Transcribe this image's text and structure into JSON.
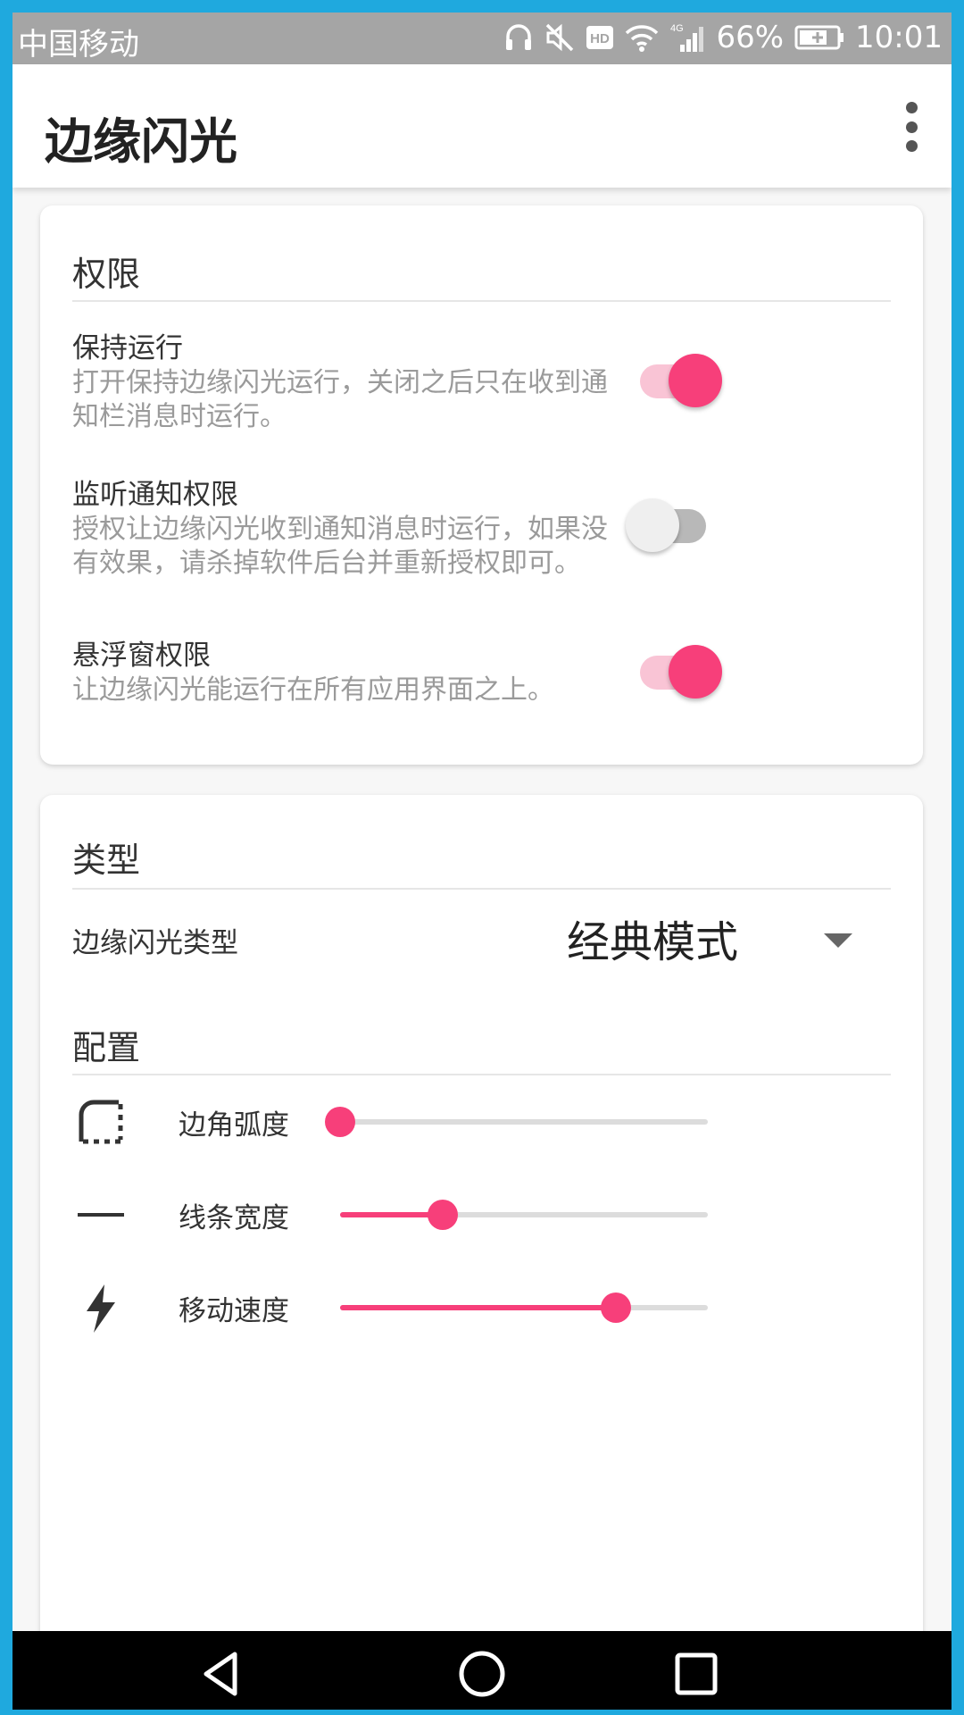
{
  "status_bar": {
    "carrier": "中国移动",
    "signal_label": "4G",
    "battery": "66%",
    "time": "10:01",
    "icons": [
      "headphones-icon",
      "mute-icon",
      "hd-icon",
      "wifi-icon",
      "signal-icon",
      "battery-charging-icon"
    ]
  },
  "app_bar": {
    "title": "边缘闪光",
    "more_icon": "more-vert-icon"
  },
  "permissions": {
    "title": "权限",
    "items": [
      {
        "title": "保持运行",
        "summary": "打开保持边缘闪光运行，关闭之后只在收到通知栏消息时运行。",
        "enabled": true
      },
      {
        "title": "监听通知权限",
        "summary": "授权让边缘闪光收到通知消息时运行，如果没有效果，请杀掉软件后台并重新授权即可。",
        "enabled": false
      },
      {
        "title": "悬浮窗权限",
        "summary": "让边缘闪光能运行在所有应用界面之上。",
        "enabled": true
      }
    ]
  },
  "type_section": {
    "title": "类型",
    "label": "边缘闪光类型",
    "selected": "经典模式"
  },
  "config_section": {
    "title": "配置",
    "sliders": [
      {
        "label": "边角弧度",
        "icon": "rounded-corner-icon",
        "value": 0.0
      },
      {
        "label": "线条宽度",
        "icon": "line-width-icon",
        "value": 0.28
      },
      {
        "label": "移动速度",
        "icon": "lightning-icon",
        "value": 0.75
      }
    ]
  },
  "nav_bar": {
    "icons": [
      "back-icon",
      "home-icon",
      "recents-icon"
    ]
  },
  "colors": {
    "accent": "#f73f7a",
    "accent_light": "#f9c4d5",
    "frame": "#1fa9de"
  }
}
